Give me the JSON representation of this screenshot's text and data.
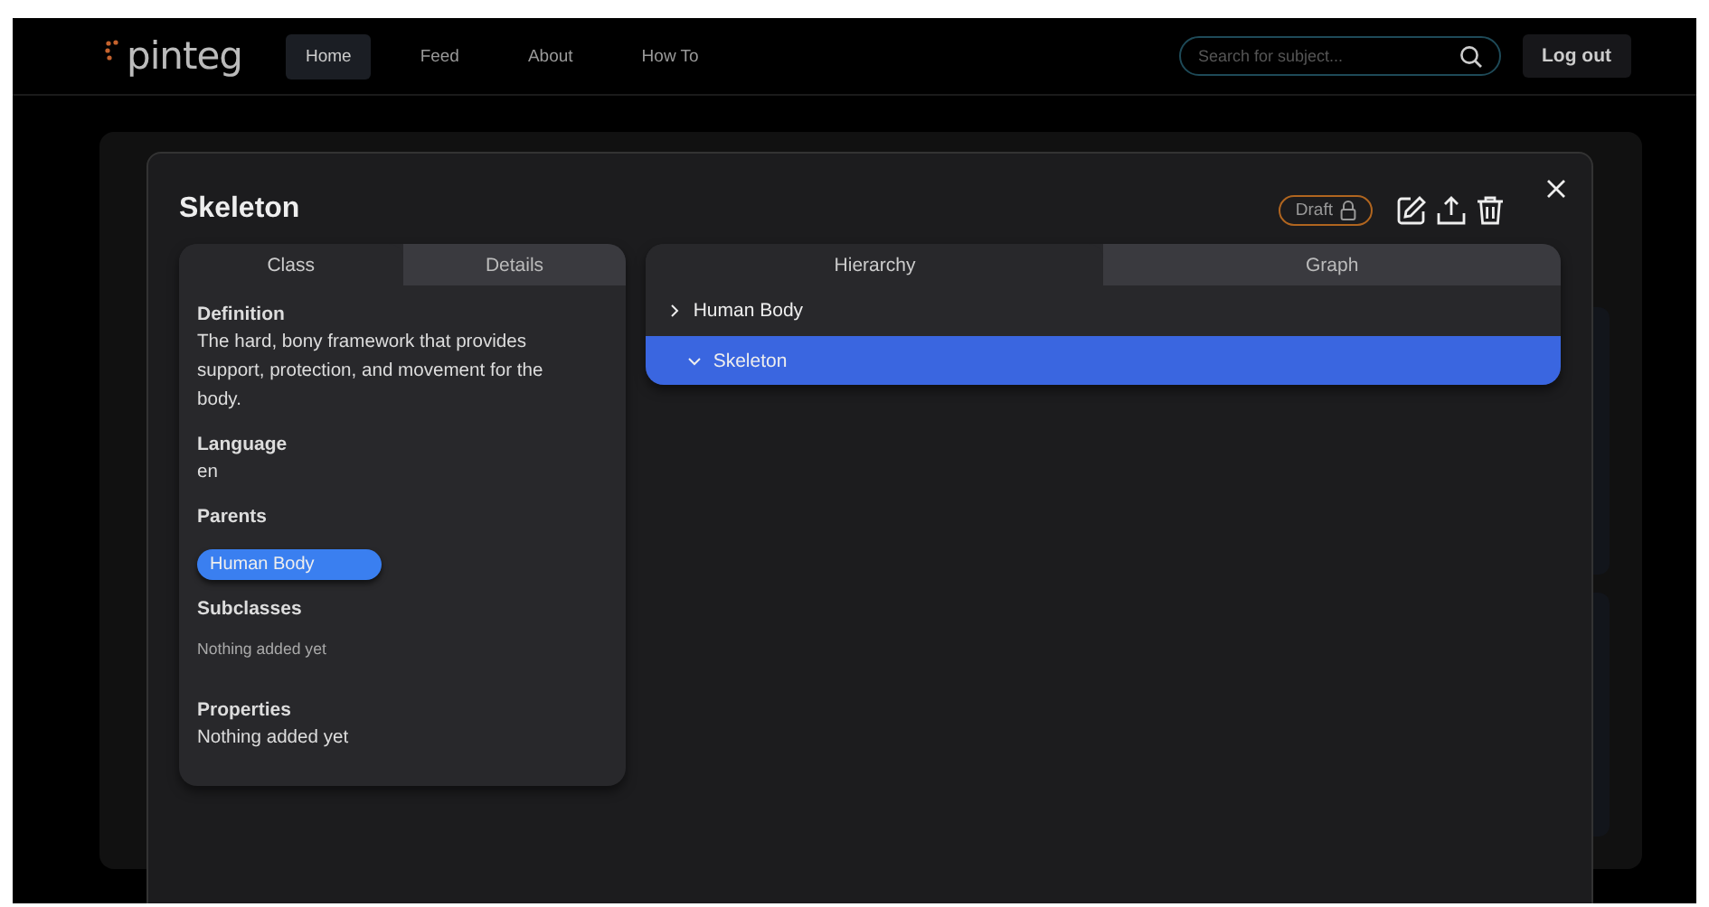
{
  "nav": {
    "logo": "pinteg",
    "links": [
      {
        "label": "Home",
        "selected": true
      },
      {
        "label": "Feed",
        "selected": false
      },
      {
        "label": "About",
        "selected": false
      },
      {
        "label": "How To",
        "selected": false
      }
    ],
    "search": {
      "placeholder": "Search for subject..."
    },
    "logout": "Log out"
  },
  "modal": {
    "title": "Skeleton",
    "status": "Draft",
    "left_tabs": [
      {
        "label": "Class",
        "selected": true
      },
      {
        "label": "Details",
        "selected": false
      }
    ],
    "sections": [
      {
        "kind": "text",
        "heading": "Definition",
        "body": "The hard, bony framework that provides support, protection, and movement for the body."
      },
      {
        "kind": "text",
        "heading": "Language",
        "body": "en"
      },
      {
        "kind": "chips",
        "heading": "Parents",
        "chips": [
          "Human Body"
        ]
      },
      {
        "kind": "empty",
        "heading": "Subclasses",
        "body": "Nothing added yet"
      },
      {
        "kind": "text",
        "heading": "Properties",
        "body": "Nothing added yet"
      }
    ],
    "right_tabs": [
      {
        "label": "Hierarchy",
        "selected": true
      },
      {
        "label": "Graph",
        "selected": false
      }
    ],
    "tree": [
      {
        "label": "Human Body",
        "expanded": false,
        "selected": false,
        "children": [
          {
            "label": "Skeleton",
            "expanded": true,
            "selected": true
          }
        ]
      }
    ]
  }
}
